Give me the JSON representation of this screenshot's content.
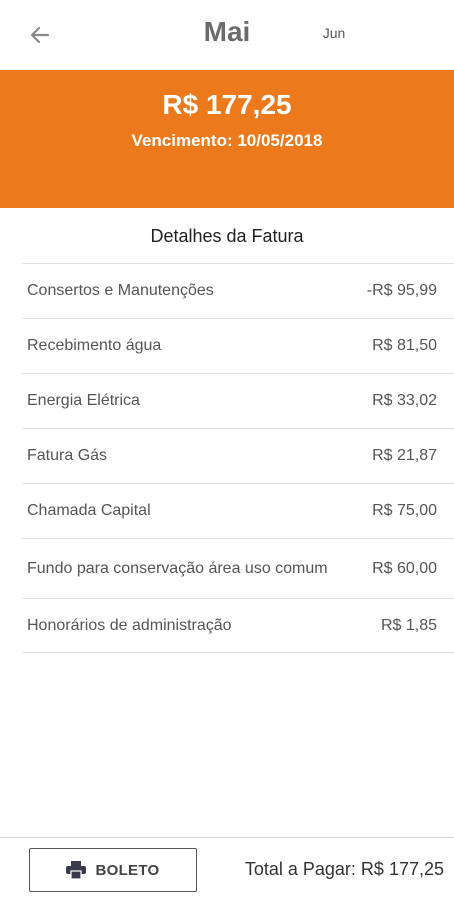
{
  "header": {
    "back_icon": "arrow-left-icon",
    "current_month": "Mai",
    "next_month": "Jun"
  },
  "summary": {
    "amount": "R$ 177,25",
    "due_date": "Vencimento: 10/05/2018",
    "color": "#ec7a1c"
  },
  "details": {
    "title": "Detalhes da Fatura",
    "items": [
      {
        "label": "Consertos e Manutenções",
        "value": "-R$ 95,99"
      },
      {
        "label": "Recebimento água",
        "value": "R$ 81,50"
      },
      {
        "label": "Energia Elétrica",
        "value": "R$ 33,02"
      },
      {
        "label": "Fatura Gás",
        "value": "R$ 21,87"
      },
      {
        "label": "Chamada Capital",
        "value": "R$ 75,00"
      },
      {
        "label": "Fundo para conservação área uso comum",
        "value": "R$ 60,00"
      },
      {
        "label": "Honorários de administração",
        "value": "R$ 1,85"
      }
    ]
  },
  "footer": {
    "boleto_icon": "printer-icon",
    "boleto_label": "BOLETO",
    "total_label": "Total a Pagar: R$  177,25"
  }
}
